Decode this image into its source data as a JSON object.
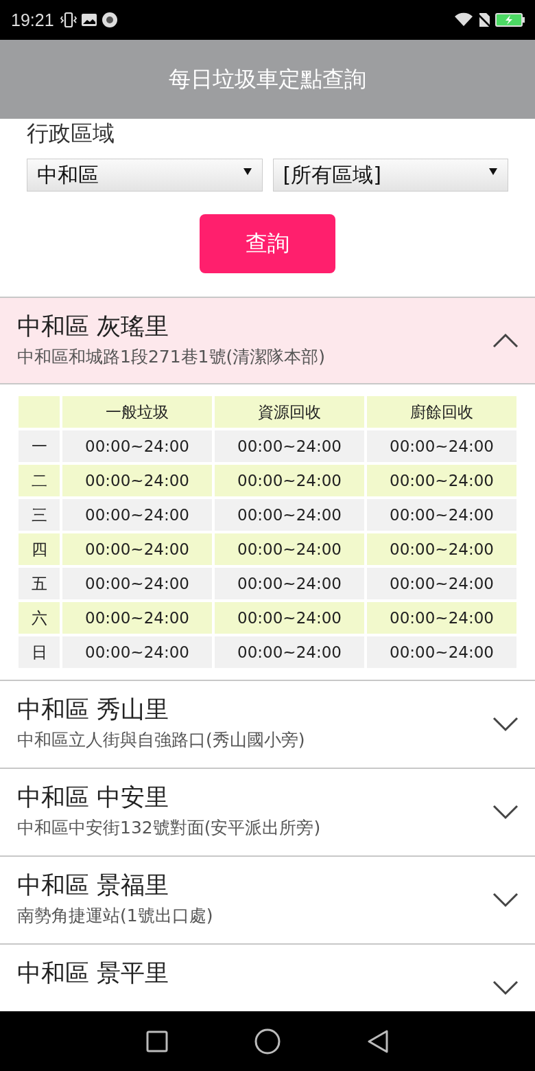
{
  "status_bar": {
    "time": "19:21"
  },
  "header": {
    "title": "每日垃圾車定點查詢"
  },
  "form": {
    "label": "行政區域",
    "selects": [
      {
        "value": "中和區"
      },
      {
        "value": "[所有區域]"
      }
    ],
    "button": "查詢"
  },
  "items": [
    {
      "title": "中和區 灰瑤里",
      "address": "中和區和城路1段271巷1號(清潔隊本部)",
      "expanded": true,
      "schedule": {
        "columns": [
          "一般垃圾",
          "資源回收",
          "廚餘回收"
        ],
        "rows": [
          {
            "day": "一",
            "times": [
              "00:00~24:00",
              "00:00~24:00",
              "00:00~24:00"
            ]
          },
          {
            "day": "二",
            "times": [
              "00:00~24:00",
              "00:00~24:00",
              "00:00~24:00"
            ]
          },
          {
            "day": "三",
            "times": [
              "00:00~24:00",
              "00:00~24:00",
              "00:00~24:00"
            ]
          },
          {
            "day": "四",
            "times": [
              "00:00~24:00",
              "00:00~24:00",
              "00:00~24:00"
            ]
          },
          {
            "day": "五",
            "times": [
              "00:00~24:00",
              "00:00~24:00",
              "00:00~24:00"
            ]
          },
          {
            "day": "六",
            "times": [
              "00:00~24:00",
              "00:00~24:00",
              "00:00~24:00"
            ]
          },
          {
            "day": "日",
            "times": [
              "00:00~24:00",
              "00:00~24:00",
              "00:00~24:00"
            ]
          }
        ]
      }
    },
    {
      "title": "中和區 秀山里",
      "address": "中和區立人街與自強路口(秀山國小旁)",
      "expanded": false
    },
    {
      "title": "中和區 中安里",
      "address": "中和區中安街132號對面(安平派出所旁)",
      "expanded": false
    },
    {
      "title": "中和區 景福里",
      "address": "南勢角捷運站(1號出口處)",
      "expanded": false
    },
    {
      "title": "中和區 景平里",
      "expanded": false
    }
  ]
}
